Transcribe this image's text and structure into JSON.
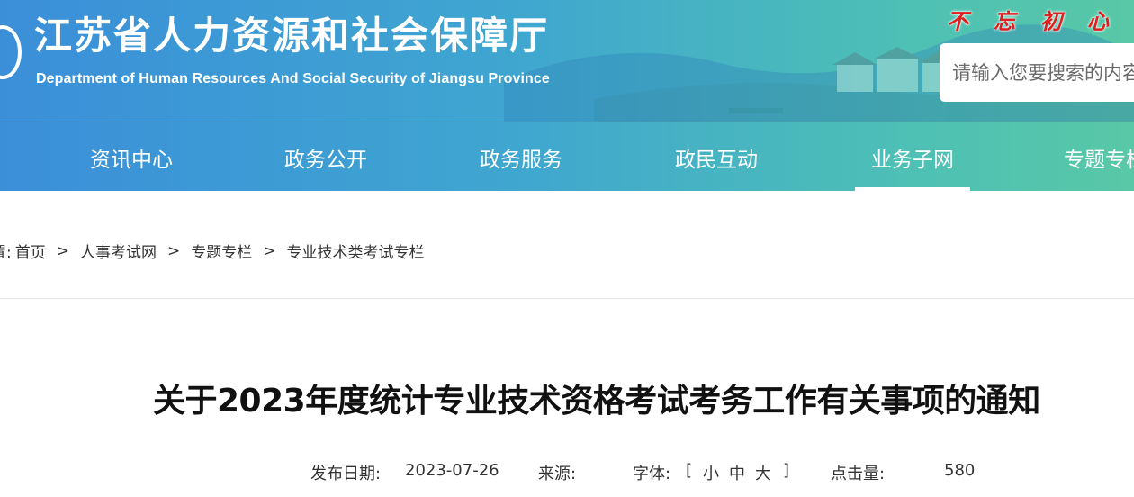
{
  "header": {
    "title": "江苏省人力资源和社会保障厅",
    "subtitle": "Department of Human Resources And Social Security of Jiangsu Province",
    "slogan": [
      "不",
      "忘",
      "初",
      "心"
    ],
    "search_placeholder": "请输入您要搜索的内容"
  },
  "nav": {
    "items": [
      "资讯中心",
      "政务公开",
      "政务服务",
      "政民互动",
      "业务子网",
      "专题专栏"
    ],
    "active": "业务子网"
  },
  "breadcrumb": {
    "prefix": "置:",
    "items": [
      "首页",
      "人事考试网",
      "专题专栏",
      "专业技术类考试专栏"
    ],
    "separator": ">"
  },
  "article": {
    "title": "关于2023年度统计专业技术资格考试考务工作有关事项的通知",
    "publish_label": "发布日期:",
    "publish_date": "2023-07-26",
    "source_label": "来源:",
    "source_value": "",
    "font_label": "字体:",
    "font_open": "[",
    "font_small": "小",
    "font_medium": "中",
    "font_large": "大",
    "font_close": "]",
    "hits_label": "点击量:",
    "hits_value": "580"
  },
  "colors": {
    "header_gradient_start": "#3b8fd9",
    "header_gradient_end": "#58c8a6",
    "slogan": "#e01e1e"
  }
}
